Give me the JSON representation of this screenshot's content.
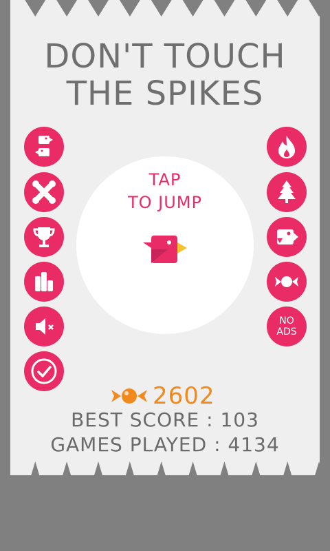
{
  "title": {
    "line1": "DON'T TOUCH",
    "line2": "THE SPIKES"
  },
  "colors": {
    "accent": "#ea2c66",
    "background": "#808080",
    "card": "#efefef",
    "text": "#6f6f6f",
    "candy": "#f08a1e",
    "bird_beak": "#f2c230"
  },
  "left_buttons": [
    {
      "icon": "two-birds-icon"
    },
    {
      "icon": "crossed-bones-icon"
    },
    {
      "icon": "trophy-icon"
    },
    {
      "icon": "leaderboard-icon"
    },
    {
      "icon": "sound-muted-icon"
    },
    {
      "icon": "check-icon"
    }
  ],
  "right_buttons": [
    {
      "icon": "fire-icon"
    },
    {
      "icon": "tree-icon"
    },
    {
      "icon": "bird-face-icon"
    },
    {
      "icon": "candy-icon"
    },
    {
      "label": "NO\nADS"
    }
  ],
  "play": {
    "line1": "TAP",
    "line2": "TO JUMP"
  },
  "candy": {
    "icon": "candy-icon",
    "count": "2602"
  },
  "stats": {
    "best_score": "BEST SCORE : 103",
    "games_played": "GAMES PLAYED : 4134"
  }
}
